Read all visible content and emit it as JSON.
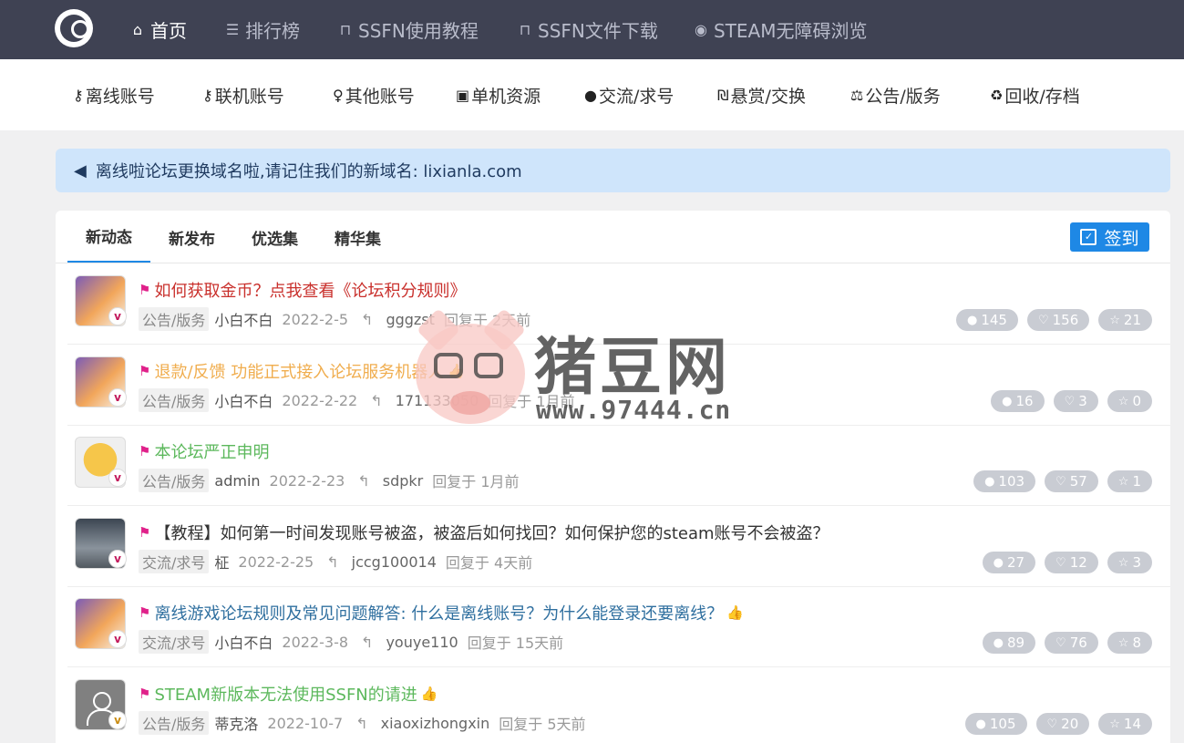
{
  "topnav": [
    {
      "label": "首页",
      "icon": "home-icon",
      "glyph": "⌂",
      "active": true
    },
    {
      "label": "排行榜",
      "icon": "list-icon",
      "glyph": "☰"
    },
    {
      "label": "SSFN使用教程",
      "icon": "unlock-icon",
      "glyph": "🔓"
    },
    {
      "label": "SSFN文件下载",
      "icon": "lock-icon",
      "glyph": "🔒"
    },
    {
      "label": "STEAM无障碍浏览",
      "icon": "steam-icon",
      "glyph": "◉"
    }
  ],
  "subnav": [
    {
      "label": "离线账号",
      "icon": "key-icon",
      "glyph": "🔑"
    },
    {
      "label": "联机账号",
      "icon": "key-icon",
      "glyph": "🔑"
    },
    {
      "label": "其他账号",
      "icon": "user-key-icon",
      "glyph": "♀"
    },
    {
      "label": "单机资源",
      "icon": "gamepad-icon",
      "glyph": "▣"
    },
    {
      "label": "交流/求号",
      "icon": "comment-icon",
      "glyph": "💬"
    },
    {
      "label": "悬赏/交换",
      "icon": "currency-icon",
      "glyph": "₪"
    },
    {
      "label": "公告/版务",
      "icon": "balance-icon",
      "glyph": "⚖"
    },
    {
      "label": "回收/存档",
      "icon": "recycle-icon",
      "glyph": "♻"
    }
  ],
  "notice": {
    "text": "离线啦论坛更换域名啦,请记住我们的新域名: lixianla.com",
    "icon": "bullhorn-icon",
    "glyph": "📢"
  },
  "tabs": [
    "新动态",
    "新发布",
    "优选集",
    "精华集"
  ],
  "signin_label": "签到",
  "threads": [
    {
      "title": "如何获取金币？点我查看《论坛积分规则》",
      "color": "#c9302c",
      "thumb": false,
      "category": "公告/版务",
      "author": "小白不白",
      "date": "2022-2-5",
      "replier": "gggzst",
      "ago": "回复于 2天前",
      "comments": "145",
      "likes": "156",
      "favs": "21",
      "avatar": "cartoon",
      "badge": "v"
    },
    {
      "title": "退款/反馈 功能正式接入论坛服务机器人",
      "color": "#f0ad4e",
      "thumb": true,
      "category": "公告/版务",
      "author": "小白不白",
      "date": "2022-2-22",
      "replier": "171133050",
      "ago": "回复于 1月前",
      "comments": "16",
      "likes": "3",
      "favs": "0",
      "avatar": "cartoon",
      "badge": "v"
    },
    {
      "title": "本论坛严正申明",
      "color": "#5cb85c",
      "thumb": false,
      "category": "公告/版务",
      "author": "admin",
      "date": "2022-2-23",
      "replier": "sdpkr",
      "ago": "回复于 1月前",
      "comments": "103",
      "likes": "57",
      "favs": "1",
      "avatar": "emoji",
      "badge": "v"
    },
    {
      "title": "【教程】如何第一时间发现账号被盗，被盗后如何找回？如何保护您的steam账号不会被盗？",
      "color": "#333333",
      "thumb": false,
      "category": "交流/求号",
      "author": "柾",
      "date": "2022-2-25",
      "replier": "jccg100014",
      "ago": "回复于 4天前",
      "comments": "27",
      "likes": "12",
      "favs": "3",
      "avatar": "photo",
      "badge": "v"
    },
    {
      "title": "离线游戏论坛规则及常见问题解答: 什么是离线账号？为什么能登录还要离线？",
      "color": "#2f6f9f",
      "thumb": true,
      "category": "交流/求号",
      "author": "小白不白",
      "date": "2022-3-8",
      "replier": "youye110",
      "ago": "回复于 15天前",
      "comments": "89",
      "likes": "76",
      "favs": "8",
      "avatar": "cartoon",
      "badge": "v"
    },
    {
      "title": "STEAM新版本无法使用SSFN的请进",
      "color": "#5cb85c",
      "thumb": true,
      "category": "公告/版务",
      "author": "蒂克洛",
      "date": "2022-10-7",
      "replier": "xiaoxizhongxin",
      "ago": "回复于 5天前",
      "comments": "105",
      "likes": "20",
      "favs": "14",
      "avatar": "default",
      "badge": "v-gold"
    }
  ],
  "watermark": {
    "cn": "猪豆网",
    "url": "www.97444.cn"
  },
  "colors": {
    "topbar": "#3f4253",
    "accent": "#1e88e5",
    "notice_bg": "#cfe5fb",
    "flag": "#e0218a"
  }
}
